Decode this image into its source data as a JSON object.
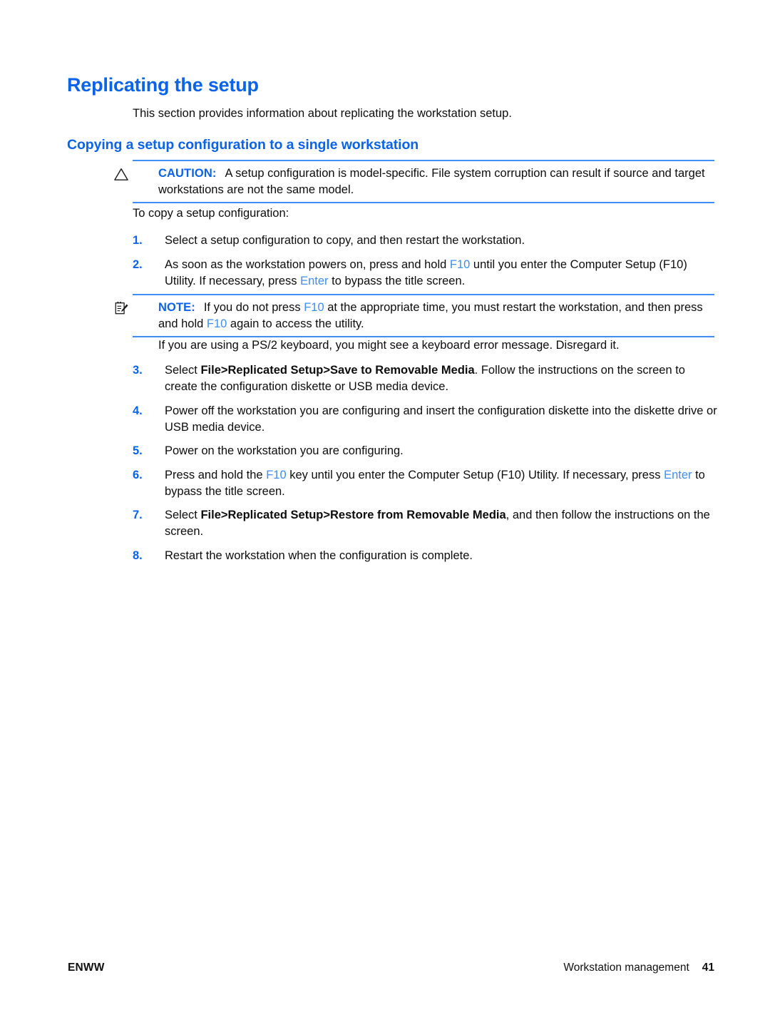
{
  "page": {
    "heading": "Replicating the setup",
    "intro": "This section provides information about replicating the workstation setup.",
    "subheading": "Copying a setup configuration to a single workstation",
    "lead_in": "To copy a setup configuration:"
  },
  "caution": {
    "icon": "warning-triangle-icon",
    "label": "CAUTION:",
    "text": "A setup configuration is model-specific. File system corruption can result if source and target workstations are not the same model."
  },
  "note": {
    "icon": "notepad-pencil-icon",
    "label": "NOTE:",
    "text_part1": "If you do not press ",
    "key1": "F10",
    "text_part2": " at the appropriate time, you must restart the workstation, and then press and hold ",
    "key2": "F10",
    "text_part3": " again to access the utility."
  },
  "steps": [
    {
      "num": "1.",
      "segments": [
        {
          "type": "text",
          "value": "Select a setup configuration to copy, and then restart the workstation."
        }
      ]
    },
    {
      "num": "2.",
      "segments": [
        {
          "type": "text",
          "value": "As soon as the workstation powers on, press and hold "
        },
        {
          "type": "key",
          "value": "F10"
        },
        {
          "type": "text",
          "value": " until you enter the Computer Setup (F10) Utility. If necessary, press "
        },
        {
          "type": "key",
          "value": "Enter"
        },
        {
          "type": "text",
          "value": " to bypass the title screen."
        }
      ]
    },
    {
      "num": "3.",
      "segments": [
        {
          "type": "text",
          "value": "Select "
        },
        {
          "type": "bold",
          "value": "File>Replicated Setup>Save to Removable Media"
        },
        {
          "type": "text",
          "value": ". Follow the instructions on the screen to create the configuration diskette or USB media device."
        }
      ]
    },
    {
      "num": "4.",
      "segments": [
        {
          "type": "text",
          "value": "Power off the workstation you are configuring and insert the configuration diskette into the diskette drive or USB media device."
        }
      ]
    },
    {
      "num": "5.",
      "segments": [
        {
          "type": "text",
          "value": "Power on the workstation you are configuring."
        }
      ]
    },
    {
      "num": "6.",
      "segments": [
        {
          "type": "text",
          "value": "Press and hold the "
        },
        {
          "type": "key",
          "value": "F10"
        },
        {
          "type": "text",
          "value": " key until you enter the Computer Setup (F10) Utility. If necessary, press "
        },
        {
          "type": "key",
          "value": "Enter"
        },
        {
          "type": "text",
          "value": " to bypass the title screen."
        }
      ]
    },
    {
      "num": "7.",
      "segments": [
        {
          "type": "text",
          "value": "Select "
        },
        {
          "type": "bold",
          "value": "File>Replicated Setup>Restore from Removable Media"
        },
        {
          "type": "text",
          "value": ", and then follow the instructions on the screen."
        }
      ]
    },
    {
      "num": "8.",
      "segments": [
        {
          "type": "text",
          "value": "Restart the workstation when the configuration is complete."
        }
      ]
    }
  ],
  "interstitial": {
    "text": "If you are using a PS/2 keyboard, you might see a keyboard error message. Disregard it."
  },
  "footer": {
    "left": "ENWW",
    "right": "Workstation management",
    "page_number": "41"
  },
  "colors": {
    "heading_blue": "#0a63e8",
    "rule_blue": "#3d8ef5",
    "key_blue": "#3d8ef5",
    "body_black": "#0d0d0d"
  }
}
